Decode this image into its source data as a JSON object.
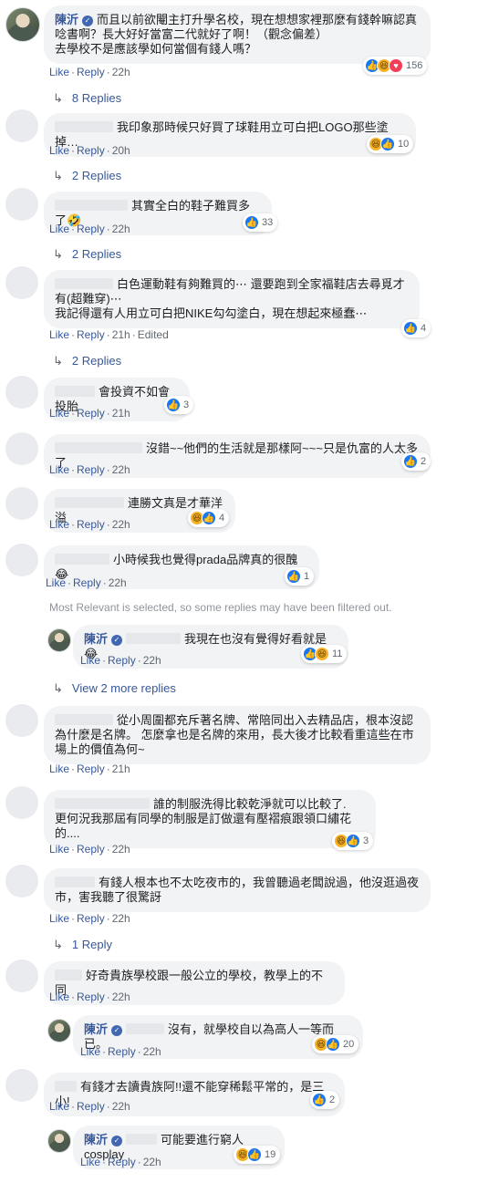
{
  "actions": {
    "like": "Like",
    "reply": "Reply",
    "sep": "·",
    "edited": "Edited"
  },
  "comments": [
    {
      "author": "陳沂",
      "text": "而且以前欲閹主打升學名校，現在想想家裡那麼有錢幹嘛認真唸書啊？長大好好當富二代就好了啊！（觀念偏差）\n去學校不是應該學如何當個有錢人嗎？",
      "time": "22h",
      "reactions": [
        "like-icon",
        "haha-icon",
        "love-icon"
      ],
      "count": "156",
      "replies": "8 Replies"
    },
    {
      "text": "我印象那時候只好買了球鞋用立可白把LOGO那些塗掉…",
      "time": "20h",
      "reactions": [
        "haha-icon",
        "like-icon"
      ],
      "count": "10",
      "replies": "2 Replies"
    },
    {
      "text": "其實全白的鞋子難買多了🤣",
      "time": "22h",
      "reactions": [
        "like-icon"
      ],
      "count": "33",
      "replies": "2 Replies"
    },
    {
      "text": "白色運動鞋有夠難買的⋯ 還要跑到全家福鞋店去尋覓才有(超難穿)⋯\n我記得還有人用立可白把NIKE勾勾塗白，現在想起來極蠢⋯",
      "time": "21h",
      "edited": true,
      "reactions": [
        "like-icon"
      ],
      "count": "4",
      "replies": "2 Replies"
    },
    {
      "text": "會投資不如會投胎",
      "time": "21h",
      "reactions": [
        "like-icon"
      ],
      "count": "3"
    },
    {
      "text": "沒錯~~他們的生活就是那樣阿~~~只是仇富的人太多了",
      "time": "22h",
      "reactions": [
        "like-icon"
      ],
      "count": "2"
    },
    {
      "text": "連勝文真是才華洋溢",
      "time": "22h",
      "reactions": [
        "haha-icon",
        "like-icon"
      ],
      "count": "4"
    },
    {
      "text": "小時候我也覺得prada品牌真的很醜😂",
      "time": "22h",
      "reactions": [
        "like-icon"
      ],
      "count": "1"
    },
    {
      "author": "陳沂",
      "text": "我現在也沒有覺得好看就是😂",
      "time": "22h",
      "reactions": [
        "like-icon",
        "haha-icon"
      ],
      "count": "11"
    },
    {
      "text": "從小周圍都充斥著名牌、常陪同出入去精品店，根本沒認為什麼是名牌。 怎麼拿也是名牌的來用，長大後才比較看重這些在市場上的價值為何~",
      "time": "21h"
    },
    {
      "text": "誰的制服洗得比較乾淨就可以比較了.\n更何況我那屆有同學的制服是訂做還有壓褶痕跟領口繡花的....",
      "time": "22h",
      "reactions": [
        "haha-icon",
        "like-icon"
      ],
      "count": "3"
    },
    {
      "text": "有錢人根本也不太吃夜市的，我曾聽過老闆說過，他沒逛過夜市，害我聽了很驚訝",
      "time": "22h",
      "replies": "1 Reply"
    },
    {
      "text": "好奇貴族學校跟一般公立的學校，教學上的不同",
      "time": "22h"
    },
    {
      "author": "陳沂",
      "text": "沒有，就學校自以為高人一等而已。",
      "time": "22h",
      "reactions": [
        "haha-icon",
        "like-icon"
      ],
      "count": "20"
    },
    {
      "text": "有錢才去讀貴族阿!!還不能穿稀鬆平常的，是三小!",
      "time": "22h",
      "reactions": [
        "like-icon"
      ],
      "count": "2"
    },
    {
      "author": "陳沂",
      "text": "可能要進行窮人cosplay",
      "time": "22h",
      "reactions": [
        "haha-icon",
        "like-icon"
      ],
      "count": "19"
    }
  ],
  "notice": "Most Relevant is selected, so some replies may have been filtered out.",
  "view_more": "View 2 more replies",
  "colors": {
    "link": "#385898",
    "bubble": "#f2f3f5",
    "like": "#1877f2",
    "haha": "#f7b125",
    "love": "#f33e58"
  }
}
